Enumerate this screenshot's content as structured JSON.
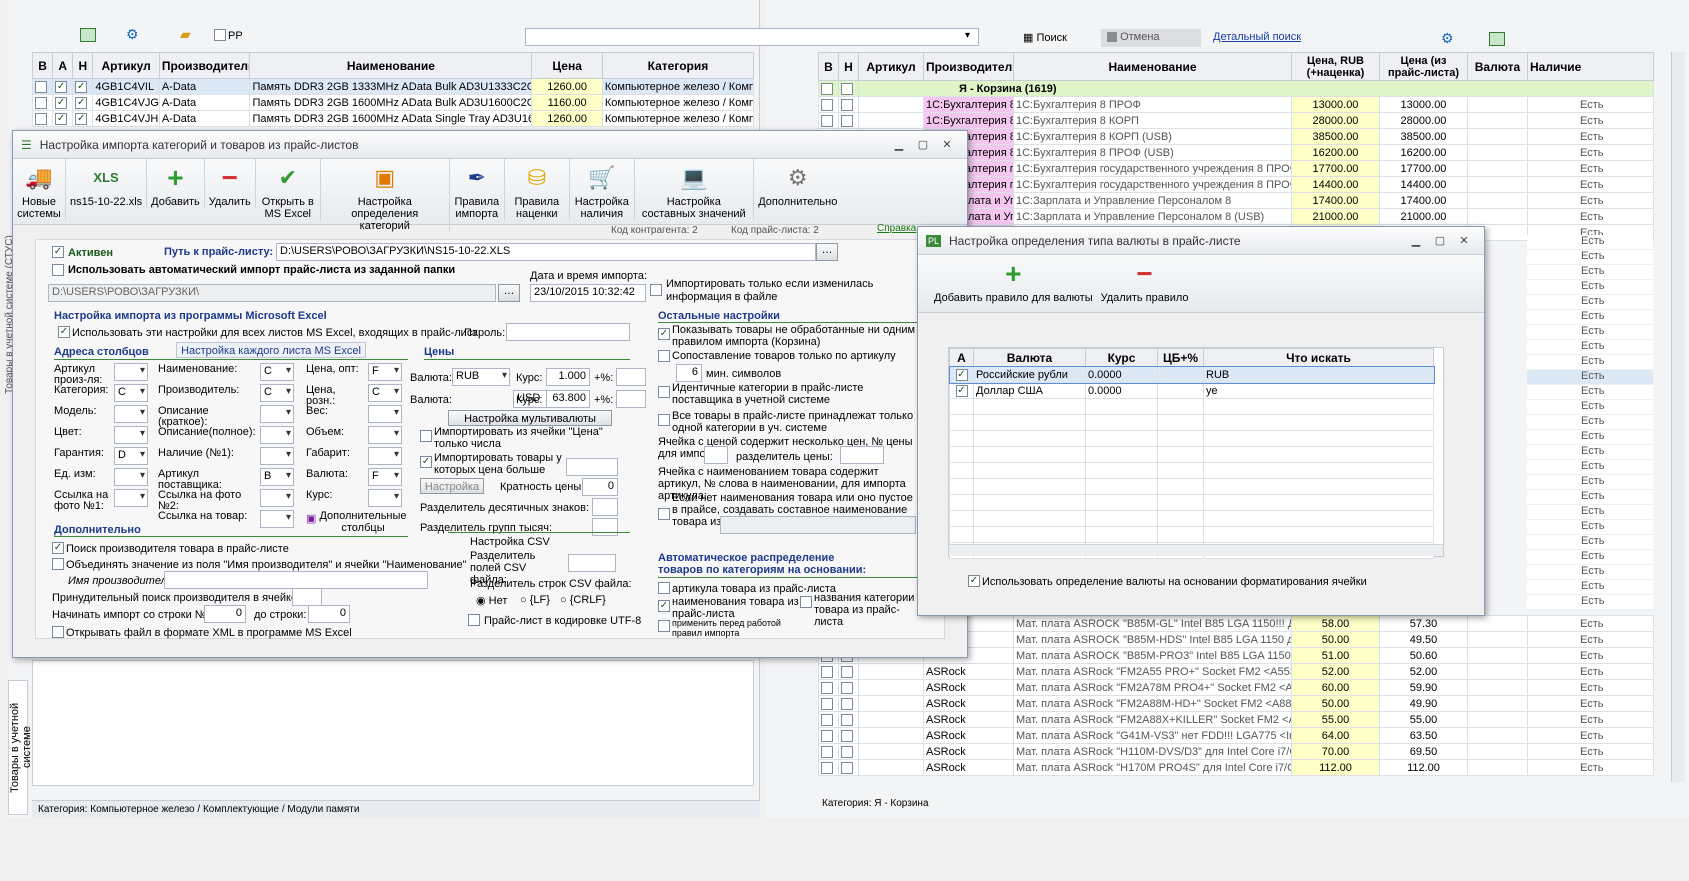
{
  "left_panel": {
    "toolbar": {
      "pp_label": "PP"
    },
    "columns": [
      "В",
      "А",
      "Н",
      "Артикул",
      "Производитель",
      "Наименование",
      "Цена",
      "Категория"
    ],
    "rows": [
      {
        "art": "4GB1C4VIL",
        "maker": "A-Data",
        "name": "Память DDR3  2GB 1333MHz AData Bulk  AD3U1333C2G9-B",
        "price": "1260.00",
        "cat": "Компьютерное железо / Компл"
      },
      {
        "art": "4GB1C4VJG",
        "maker": "A-Data",
        "name": "Память DDR3  2GB 1600MHz AData Bulk AD3U1600C2G11-B",
        "price": "1160.00",
        "cat": "Компьютерное железо / Компл"
      },
      {
        "art": "4GB1C4VJH",
        "maker": "A-Data",
        "name": "Память DDR3  2GB 1600MHz AData Single Tray  AD3U1600C2G",
        "price": "1260.00",
        "cat": "Компьютерное железо / Компл"
      }
    ],
    "status": "Категория: Компьютерное железо / Комплектующие / Модули памяти",
    "side_tab_top": "Товары в учетной системе (СТУС)",
    "side_tab_bottom": "Товары в учетной системе"
  },
  "right_panel": {
    "search_label": "Поиск",
    "cancel_label": "Отмена",
    "detail_search": "Детальный поиск",
    "columns": [
      "В",
      "Н",
      "Артикул",
      "Производитель",
      "Наименование",
      "Цена, RUB (+наценка)",
      "Цена (из прайс-листа)",
      "Валюта",
      "Наличие"
    ],
    "group_row": "Я - Корзина (1619)",
    "rows": [
      {
        "maker": "1С:Бухгалтерия 8",
        "name": "1С:Бухгалтерия 8 ПРОФ",
        "p1": "13000.00",
        "p2": "13000.00",
        "avail": "Есть"
      },
      {
        "maker": "1С:Бухгалтерия 8",
        "name": "1С:Бухгалтерия 8 КОРП",
        "p1": "28000.00",
        "p2": "28000.00",
        "avail": "Есть"
      },
      {
        "maker": "1С:Бухгалтерия 8",
        "name": "1С:Бухгалтерия 8 КОРП (USB)",
        "p1": "38500.00",
        "p2": "38500.00",
        "avail": "Есть"
      },
      {
        "maker": "1С:Бухгалтерия 8",
        "name": "1С:Бухгалтерия 8 ПРОФ (USB)",
        "p1": "16200.00",
        "p2": "16200.00",
        "avail": "Есть"
      },
      {
        "maker": "1С:Бухгалтерия гос",
        "name": "1С:Бухгалтерия государственного учреждения 8 ПРОФ (USB)",
        "p1": "17700.00",
        "p2": "17700.00",
        "avail": "Есть"
      },
      {
        "maker": "1С:Бухгалтерия гос",
        "name": "1С:Бухгалтерия государственного учреждения 8 ПРОФ",
        "p1": "14400.00",
        "p2": "14400.00",
        "avail": "Есть"
      },
      {
        "maker": "1С:Зарплата и Упр",
        "name": "1С:Зарплата и Управление Персоналом 8",
        "p1": "17400.00",
        "p2": "17400.00",
        "avail": "Есть"
      },
      {
        "maker": "1С:Зарплата и Упр",
        "name": "1С:Зарплата и Управление Персоналом 8 (USB)",
        "p1": "21000.00",
        "p2": "21000.00",
        "avail": "Есть"
      },
      {
        "maker": "1С:Зарплата и Упр",
        "name": "1С:Зарплата и кадры бюджетного учреждения 8",
        "p1": "21600.00",
        "p2": "21600.00",
        "avail": "Есть"
      }
    ],
    "bottom_rows": [
      {
        "maker": "",
        "name": "Мат. плата ASROCK \"B85M-GL\" Intel B85 LGA 1150!!! Для Inte",
        "p1": "58.00",
        "p2": "57.30",
        "avail": "Есть"
      },
      {
        "maker": "",
        "name": "Мат. плата ASROCK \"B85M-HDS\" Intel B85 LGA 1150 для Inte",
        "p1": "50.00",
        "p2": "49.50",
        "avail": "Есть"
      },
      {
        "maker": "",
        "name": "Мат. плата ASROCK \"B85M-PRO3\" Intel B85 LGA 1150 для Inte",
        "p1": "51.00",
        "p2": "50.60",
        "avail": "Есть"
      },
      {
        "maker": "ASRock",
        "name": "Мат. плата ASRock \"FM2A55 PRO+\" Socket FM2 <A55> 2x DD",
        "p1": "52.00",
        "p2": "52.00",
        "avail": "Есть"
      },
      {
        "maker": "ASRock",
        "name": "Мат. плата ASRock \"FM2A78M PRO4+\" Socket FM2 <A78> 4x",
        "p1": "60.00",
        "p2": "59.90",
        "avail": "Есть"
      },
      {
        "maker": "ASRock",
        "name": "Мат. плата ASRock \"FM2A88M-HD+\" Socket FM2 <A88X>, 2x",
        "p1": "50.00",
        "p2": "49.90",
        "avail": "Есть"
      },
      {
        "maker": "ASRock",
        "name": "Мат. плата ASRock \"FM2A88X+KILLER\" Socket FM2 <A88X>, 2x",
        "p1": "55.00",
        "p2": "55.00",
        "avail": "Есть"
      },
      {
        "maker": "ASRock",
        "name": "Мат. плата ASRock \"G41M-VS3\" нет FDD!!! LGA775 <Intel G4",
        "p1": "64.00",
        "p2": "63.50",
        "avail": "Есть"
      },
      {
        "maker": "ASRock",
        "name": "Мат. плата ASRock \"H110M-DVS/D3\" для Intel Core i7/Core i5",
        "p1": "70.00",
        "p2": "69.50",
        "avail": "Есть"
      },
      {
        "maker": "ASRock",
        "name": "Мат. плата ASRock \"H170M PRO4S\" для Intel Core i7/Core i5",
        "p1": "112.00",
        "p2": "112.00",
        "avail": "Есть"
      }
    ],
    "extra_avail": [
      "Есть",
      "Есть",
      "Есть",
      "Есть",
      "Есть",
      "Есть",
      "Есть",
      "Есть",
      "Есть",
      "Есть",
      "Есть",
      "Есть",
      "Есть",
      "Есть",
      "Есть",
      "Есть",
      "Есть",
      "Есть",
      "Есть",
      "Есть",
      "Есть",
      "Есть",
      "Есть",
      "Есть",
      "Есть"
    ],
    "status": "Категория: Я - Корзина"
  },
  "import_window": {
    "title": "Настройка импорта категорий и товаров из прайс-листов",
    "toolbar": [
      "Новые системы",
      "ns15-10-22.xls",
      "Добавить",
      "Удалить",
      "Открыть в MS Excel",
      "Настройка определения категорий",
      "Правила импорта",
      "Правила наценки",
      "Настройка наличия",
      "Настройка составных значений",
      "Дополнительно"
    ],
    "kod_contr": "Код контрагента: 2",
    "kod_price": "Код прайс-листа: 2",
    "help": "Справка",
    "active": "Активен",
    "path_label": "Путь к прайс-листу:",
    "path_value": "D:\\USERS\\РОВО\\ЗАГРУЗКИ\\NS15-10-22.XLS",
    "auto_import": "Использовать автоматический импорт прайс-листа из заданной папки",
    "auto_path": "D:\\USERS\\РОВО\\ЗАГРУЗКИ\\",
    "date_label": "Дата и время импорта:",
    "date_value": "23/10/2015 10:32:42",
    "only_changed": "Импортировать только если изменилась информация в файле",
    "excel_section": "Настройка импорта из программы Microsoft Excel",
    "use_all_sheets": "Использовать эти настройки для всех листов MS Excel, входящих в прайс-лист",
    "password": "Пароль:",
    "addr_section": "Адреса столбцов",
    "each_sheet": "Настройка каждого листа MS Excel",
    "prices_section": "Цены",
    "c1": [
      {
        "l": "Артикул произ-ля:",
        "v": ""
      },
      {
        "l": "Категория:",
        "v": "C"
      },
      {
        "l": "Модель:",
        "v": ""
      },
      {
        "l": "Цвет:",
        "v": ""
      },
      {
        "l": "Гарантия:",
        "v": "D"
      },
      {
        "l": "Ед. изм:",
        "v": ""
      },
      {
        "l": "Ссылка на фото №1:",
        "v": ""
      }
    ],
    "c2": [
      {
        "l": "Наименование:",
        "v": "C"
      },
      {
        "l": "Производитель:",
        "v": "C"
      },
      {
        "l": "Описание (краткое):",
        "v": ""
      },
      {
        "l": "Описание(полное):",
        "v": ""
      },
      {
        "l": "Наличие (№1):",
        "v": ""
      },
      {
        "l": "Артикул поставщика:",
        "v": "B"
      },
      {
        "l": "Ссылка на фото №2:",
        "v": ""
      },
      {
        "l": "Ссылка на товар:",
        "v": ""
      }
    ],
    "c3": [
      {
        "l": "Цена, опт:",
        "v": "F"
      },
      {
        "l": "Цена, розн.:",
        "v": "C"
      },
      {
        "l": "Вес:",
        "v": ""
      },
      {
        "l": "Объем:",
        "v": ""
      },
      {
        "l": "Габарит:",
        "v": ""
      },
      {
        "l": "Валюта:",
        "v": "F"
      },
      {
        "l": "Курс:",
        "v": ""
      }
    ],
    "extra_cols": "Дополнительные столбцы",
    "cur1_label": "Валюта:",
    "cur1": "RUB",
    "rate_label": "Курс:",
    "rate1": "1.000",
    "pct_label": "+%:",
    "cur2": "USD",
    "rate2": "63.800",
    "multi_cur": "Настройка мультивалюты",
    "import_price_num": "Импортировать из ячейки \"Цена\" только числа",
    "import_price_gt": "Импортировать товары у которых цена больше чем:",
    "setup_btn": "Настройка",
    "multiplicity": "Кратность цены:",
    "multiplicity_val": "0",
    "dec_sep": "Разделитель десятичных знаков:",
    "grp_sep": "Разделитель групп тысяч:",
    "extra_section": "Дополнительно",
    "search_maker": "Поиск производителя товара в прайс-листе",
    "merge_maker": "Объединять значение из поля \"Имя производителя\" и ячейки \"Наименование\"",
    "maker_name": "Имя производителя:",
    "force_search": "Принудительный поиск производителя в ячейке:",
    "start_row": "Начинать импорт со строки №:",
    "start_val": "0",
    "to_row": "до строки:",
    "to_val": "0",
    "open_xml": "Открывать файл в формате XML в программе MS Excel",
    "csv_section": "Настройка CSV",
    "csv_field_sep": "Разделитель полей CSV файла:",
    "csv_row_sep": "Разделитель строк CSV файла:",
    "csv_opts": [
      "Нет",
      "{LF}",
      "{CRLF}"
    ],
    "utf8": "Прайс-лист в кодировке UTF-8",
    "other_section": "Остальные настройки",
    "o1": "Показывать товары не обработанные ни одним правилом импорта (Корзина)",
    "o2": "Сопоставление товаров только по артикулу",
    "o2_val": "6",
    "o2_unit": "мин. символов",
    "o3": "Идентичные категории в прайс-листе поставщика в учетной системе",
    "o4": "Все товары в прайс-листе принадлежат только одной категории в уч. системе",
    "o5": "Ячейка с ценой содержит несколько цен, № цены для импорта:",
    "o5b": "разделитель цены:",
    "o6": "Ячейка с наименованием товара содержит артикул, № слова в наименовании, для импорта артикула:",
    "o7": "Если нет наименования товара или оно пустое в прайсе, создавать составное наименование товара из ячеек:",
    "auto_section": "Автоматическое распределение товаров по категориям на основании:",
    "a1": "артикула товара из прайс-листа",
    "a2": "наименования товара из прайс-листа",
    "a3": "названия  категории товара из прайс-листа",
    "a4": "применить перед работой правил импорта"
  },
  "currency_window": {
    "title": "Настройка определения типа валюты в прайс-листе",
    "add": "Добавить правило для валюты",
    "del": "Удалить правило",
    "columns": [
      "А",
      "Валюта",
      "Курс",
      "ЦБ+%",
      "Что искать"
    ],
    "rows": [
      {
        "name": "Российские рубли",
        "rate": "0.0000",
        "cb": "",
        "find": "RUB"
      },
      {
        "name": "Доллар США",
        "rate": "0.0000",
        "cb": "",
        "find": "уе"
      }
    ],
    "use_format": "Использовать определение валюты на основании форматирования ячейки"
  }
}
